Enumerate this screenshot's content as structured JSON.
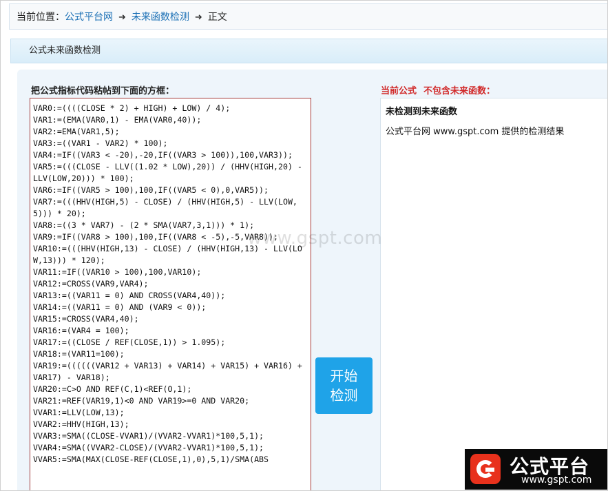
{
  "breadcrumb": {
    "label": "当前位置：",
    "items": [
      "公式平台网",
      "未来函数检测"
    ],
    "current": "正文",
    "separator": "➜"
  },
  "section": {
    "title": "公式未来函数检测"
  },
  "editor": {
    "label": "把公式指标代码粘帖到下面的方框：",
    "lines": [
      "VAR0:=((((CLOSE * 2) + HIGH) + LOW) / 4);",
      "VAR1:=(EMA(VAR0,1) - EMA(VAR0,40));",
      "VAR2:=EMA(VAR1,5);",
      "VAR3:=((VAR1 - VAR2) * 100);",
      "VAR4:=IF((VAR3 < -20),-20,IF((VAR3 > 100)),100,VAR3));",
      "VAR5:=(((CLOSE - LLV((1.02 * LOW),20)) / (HHV(HIGH,20) - LLV(LOW,20))) * 100);",
      "VAR6:=IF((VAR5 > 100),100,IF((VAR5 < 0),0,VAR5));",
      "VAR7:=(((HHV(HIGH,5) - CLOSE) / (HHV(HIGH,5) - LLV(LOW,5))) * 20);",
      "VAR8:=((3 * VAR7) - (2 * SMA(VAR7,3,1))) * 1);",
      "VAR9:=IF((VAR8 > 100),100,IF((VAR8 < -5),-5,VAR8));",
      "VAR10:=(((HHV(HIGH,13) - CLOSE) / (HHV(HIGH,13) - LLV(LOW,13))) * 120);",
      "VAR11:=IF((VAR10 > 100),100,VAR10);",
      "VAR12:=CROSS(VAR9,VAR4);",
      "VAR13:=((VAR11 = 0) AND CROSS(VAR4,40));",
      "VAR14:=((VAR11 = 0) AND (VAR9 < 0));",
      "VAR15:=CROSS(VAR4,40);",
      "VAR16:=(VAR4 = 100);",
      "VAR17:=((CLOSE / REF(CLOSE,1)) > 1.095);",
      "VAR18:=(VAR11=100);",
      "VAR19:=((((((VAR12 + VAR13) + VAR14) + VAR15) + VAR16) + VAR17) - VAR18);",
      "VAR20:=C>O AND REF(C,1)<REF(O,1);",
      "VAR21:=REF(VAR19,1)<0 AND VAR19>=0 AND VAR20;",
      "VVAR1:=LLV(LOW,13);",
      "VVAR2:=HHV(HIGH,13);",
      "VVAR3:=SMA((CLOSE-VVAR1)/(VVAR2-VVAR1)*100,5,1);",
      "VVAR4:=SMA((VVAR2-CLOSE)/(VVAR2-VVAR1)*100,5,1);",
      "VVAR5:=SMA(MAX(CLOSE-REF(CLOSE,1),0),5,1)/SMA(ABS"
    ]
  },
  "start_button": {
    "line1": "开始",
    "line2": "检测"
  },
  "result": {
    "label_part1": "当前公式",
    "label_part2": "不包含未来函数：",
    "title": "未检测到未来函数",
    "text": "公式平台网 www.gspt.com 提供的检测结果"
  },
  "watermark": {
    "text": "www.gspt.com"
  },
  "logo": {
    "name": "公式平台",
    "url": "www.gspt.com"
  },
  "colors": {
    "link": "#1a6fb5",
    "accent_red": "#d12a2a",
    "button": "#1fa3e8"
  }
}
